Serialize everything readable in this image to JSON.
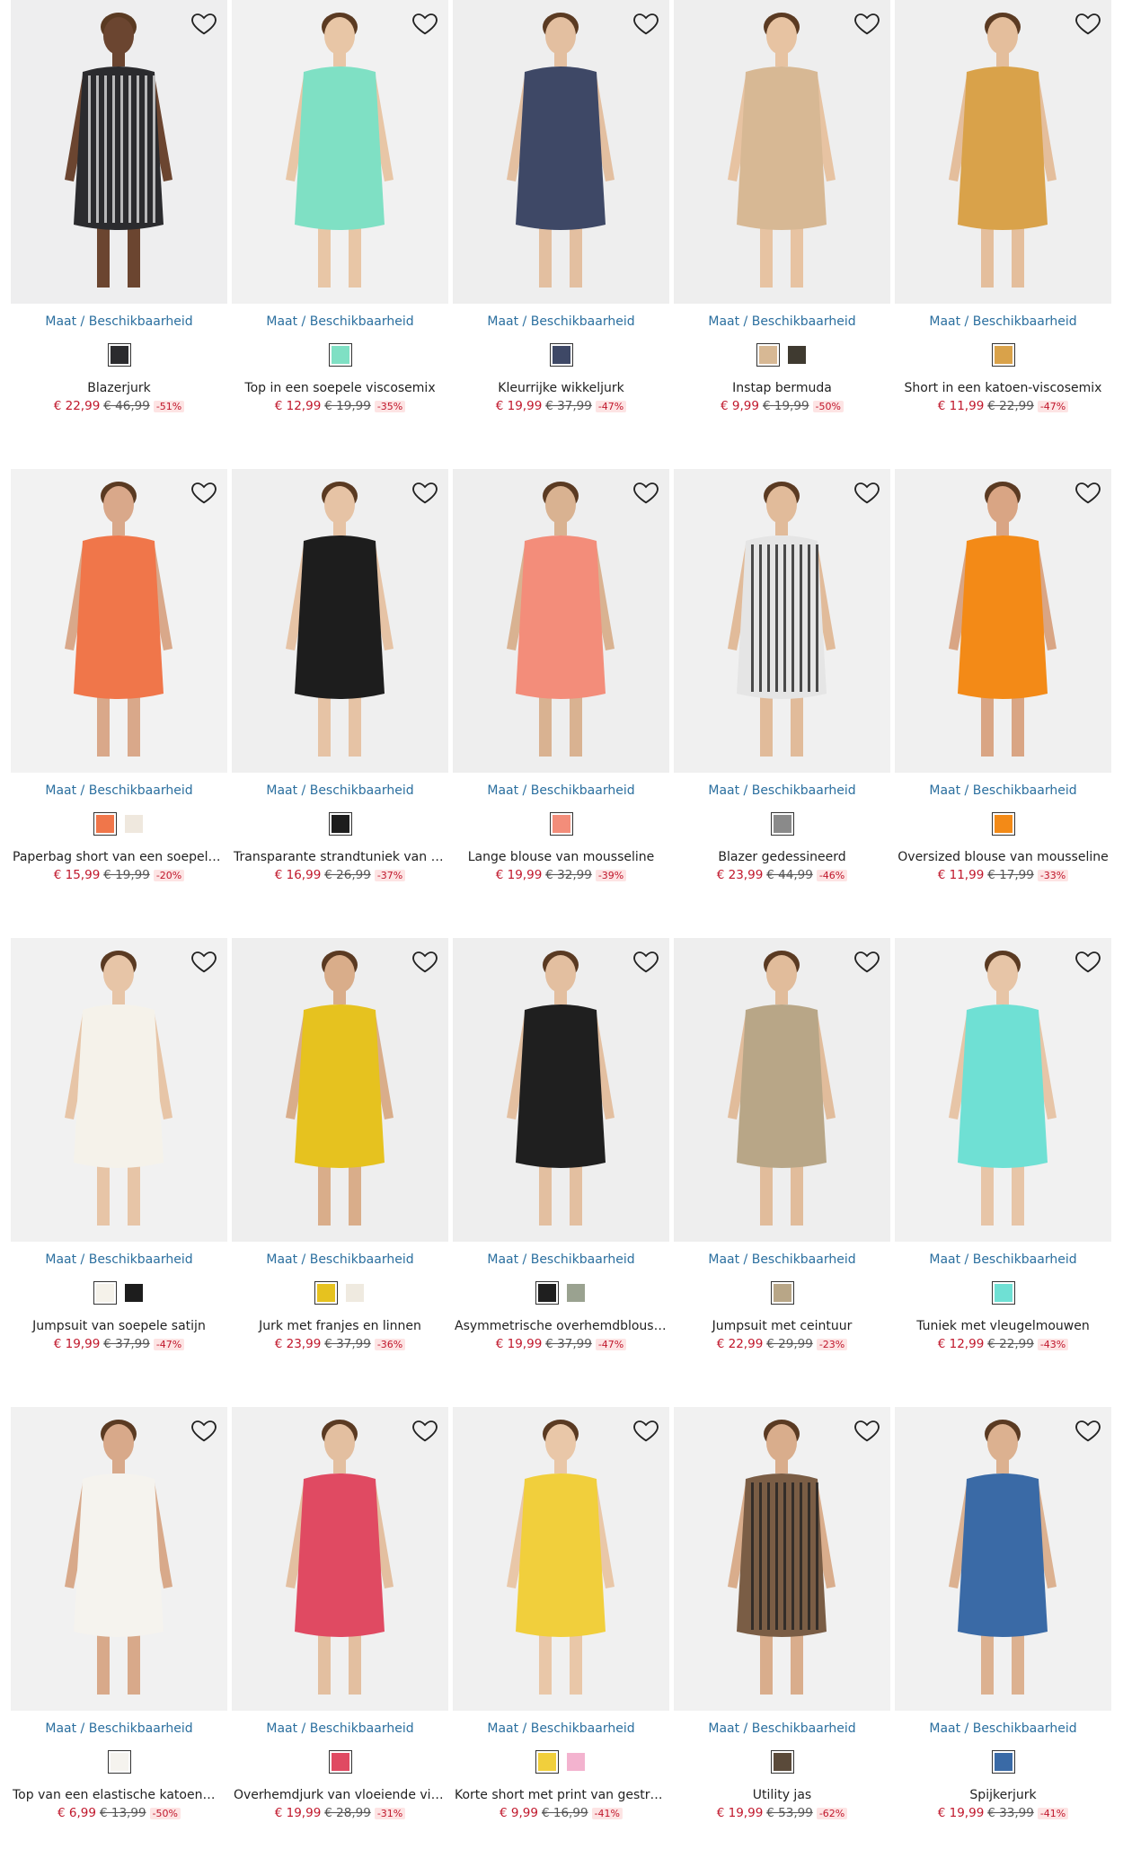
{
  "size_link_label": "Maat / Beschikbaarheid",
  "products": [
    {
      "name": "Blazerjurk",
      "price": "€ 22,99",
      "old": "€ 46,99",
      "disc": "-51%",
      "bg": "#eeeeef",
      "garment": "#2b2b2e",
      "stripe": true,
      "skin": "#6b4530",
      "swatches": [
        "#2b2b2e"
      ]
    },
    {
      "name": "Top in een soepele viscosemix",
      "price": "€ 12,99",
      "old": "€ 19,99",
      "disc": "-35%",
      "bg": "#f1f1f1",
      "garment": "#7fe0c4",
      "skin": "#e8c6a6",
      "swatches": [
        "#7fe0c4"
      ]
    },
    {
      "name": "Kleurrijke wikkeljurk",
      "price": "€ 19,99",
      "old": "€ 37,99",
      "disc": "-47%",
      "bg": "#eeeeee",
      "garment": "#3e4866",
      "skin": "#e3bfa0",
      "swatches": [
        "#3e4866"
      ]
    },
    {
      "name": "Instap bermuda",
      "price": "€ 9,99",
      "old": "€ 19,99",
      "disc": "-50%",
      "bg": "#eeeeee",
      "garment": "#d7b894",
      "skin": "#e7c3a2",
      "swatches": [
        "#d7b894",
        "#3f3a30"
      ]
    },
    {
      "name": "Short in een katoen-viscosemix",
      "price": "€ 11,99",
      "old": "€ 22,99",
      "disc": "-47%",
      "bg": "#efefef",
      "garment": "#d9a24a",
      "skin": "#e4be9c",
      "swatches": [
        "#d9a24a"
      ]
    },
    {
      "name": "Paperbag short van een soepele Ly…",
      "price": "€ 15,99",
      "old": "€ 19,99",
      "disc": "-20%",
      "bg": "#f2f2f2",
      "garment": "#f0764a",
      "skin": "#d9a88a",
      "swatches": [
        "#f0764a",
        "#efe8de"
      ]
    },
    {
      "name": "Transparante strandtuniek van visc…",
      "price": "€ 16,99",
      "old": "€ 26,99",
      "disc": "-37%",
      "bg": "#efefef",
      "garment": "#1d1d1d",
      "skin": "#e6c3a5",
      "swatches": [
        "#1d1d1d"
      ]
    },
    {
      "name": "Lange blouse van mousseline",
      "price": "€ 19,99",
      "old": "€ 32,99",
      "disc": "-39%",
      "bg": "#eeeeee",
      "garment": "#f38d7a",
      "skin": "#d9b291",
      "swatches": [
        "#f38d7a"
      ]
    },
    {
      "name": "Blazer gedessineerd",
      "price": "€ 23,99",
      "old": "€ 44,99",
      "disc": "-46%",
      "bg": "#f0f0f0",
      "garment": "#e5e5e5",
      "stripe": true,
      "skin": "#e1bb9a",
      "swatches": [
        "#8a8a8a"
      ]
    },
    {
      "name": "Oversized blouse van mousseline",
      "price": "€ 11,99",
      "old": "€ 17,99",
      "disc": "-33%",
      "bg": "#f0f0f0",
      "garment": "#f38a17",
      "skin": "#d9a584",
      "swatches": [
        "#f38a17"
      ]
    },
    {
      "name": "Jumpsuit van soepele satijn",
      "price": "€ 19,99",
      "old": "€ 37,99",
      "disc": "-47%",
      "bg": "#f1f1f1",
      "garment": "#f5f2ea",
      "skin": "#e7c5a7",
      "swatches": [
        "#f5f2ea",
        "#1d1d1d"
      ]
    },
    {
      "name": "Jurk met franjes en linnen",
      "price": "€ 23,99",
      "old": "€ 37,99",
      "disc": "-36%",
      "bg": "#eeeeee",
      "garment": "#e6c21f",
      "skin": "#d9ad8a",
      "swatches": [
        "#e6c21f",
        "#efeae0"
      ]
    },
    {
      "name": "Asymmetrische overhemdblouse va…",
      "price": "€ 19,99",
      "old": "€ 37,99",
      "disc": "-47%",
      "bg": "#eeeeee",
      "garment": "#1f1f1f",
      "skin": "#e3bfa0",
      "swatches": [
        "#1f1f1f",
        "#9aa290"
      ]
    },
    {
      "name": "Jumpsuit met ceintuur",
      "price": "€ 22,99",
      "old": "€ 29,99",
      "disc": "-23%",
      "bg": "#eeeeee",
      "garment": "#b8a687",
      "skin": "#e1bc9b",
      "swatches": [
        "#b8a687"
      ]
    },
    {
      "name": "Tuniek met vleugelmouwen",
      "price": "€ 12,99",
      "old": "€ 22,99",
      "disc": "-43%",
      "bg": "#f1f1f1",
      "garment": "#6fe0d4",
      "skin": "#e7c5a7",
      "swatches": [
        "#6fe0d4"
      ]
    },
    {
      "name": "Top van een elastische katoenmix",
      "price": "€ 6,99",
      "old": "€ 13,99",
      "disc": "-50%",
      "bg": "#f1f1f1",
      "garment": "#f5f3ee",
      "skin": "#d8a98a",
      "swatches": [
        "#f5f3ee"
      ]
    },
    {
      "name": "Overhemdjurk van vloeiende viscose",
      "price": "€ 19,99",
      "old": "€ 28,99",
      "disc": "-31%",
      "bg": "#f0f0f0",
      "garment": "#e04a62",
      "skin": "#e3bfa0",
      "swatches": [
        "#e04a62"
      ]
    },
    {
      "name": "Korte short met print van gestruct…",
      "price": "€ 9,99",
      "old": "€ 16,99",
      "disc": "-41%",
      "bg": "#f0f0f0",
      "garment": "#f1cf3c",
      "skin": "#e9c7a8",
      "swatches": [
        "#f1cf3c",
        "#f3b3cf"
      ]
    },
    {
      "name": "Utility jas",
      "price": "€ 19,99",
      "old": "€ 53,99",
      "disc": "-62%",
      "bg": "#f1f1f1",
      "garment": "#7a5d45",
      "stripe": true,
      "skin": "#d9ad8c",
      "swatches": [
        "#5a4a3a"
      ]
    },
    {
      "name": "Spijkerjurk",
      "price": "€ 19,99",
      "old": "€ 33,99",
      "disc": "-41%",
      "bg": "#f1f1f1",
      "garment": "#3a6aa6",
      "skin": "#dcb190",
      "swatches": [
        "#3a6aa6"
      ]
    }
  ]
}
